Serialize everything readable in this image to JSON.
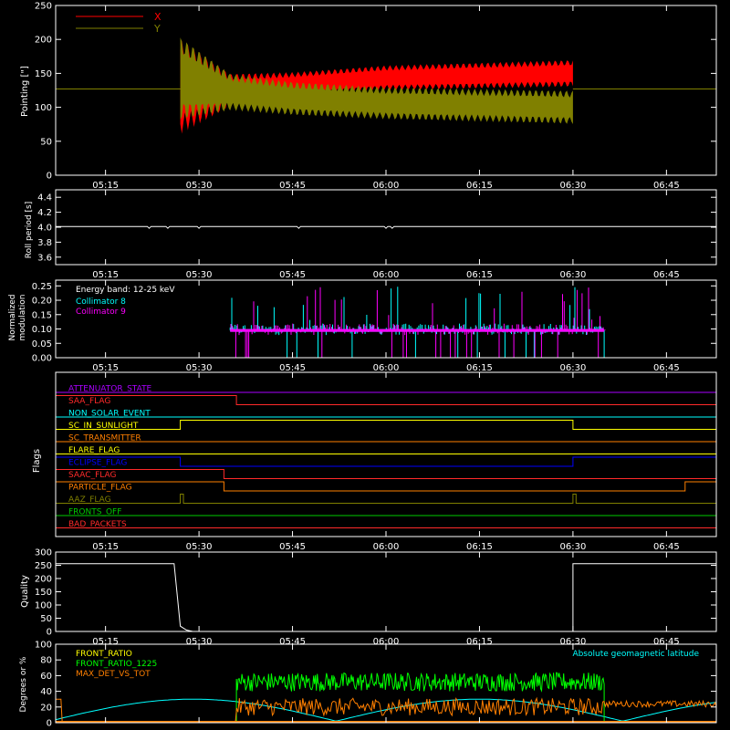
{
  "x_ticks": [
    "05:15",
    "05:30",
    "05:45",
    "06:00",
    "06:15",
    "06:30",
    "06:45"
  ],
  "panels": {
    "pointing": {
      "ylabel": "Pointing [\"]",
      "yticks": [
        "0",
        "50",
        "100",
        "150",
        "200",
        "250"
      ]
    },
    "roll": {
      "ylabel": "Roll period [s]",
      "yticks": [
        "3.6",
        "3.8",
        "4.0",
        "4.2",
        "4.4"
      ]
    },
    "modulation": {
      "ylabel_lines": [
        "Normalized",
        "modulation"
      ],
      "yticks": [
        "0.00",
        "0.05",
        "0.10",
        "0.15",
        "0.20",
        "0.25"
      ],
      "annotation": "Energy band: 12-25 keV"
    },
    "flags": {
      "ylabel": "Flags"
    },
    "quality": {
      "ylabel": "Quality",
      "yticks": [
        "0",
        "50",
        "100",
        "150",
        "200",
        "250",
        "300"
      ]
    },
    "ratios": {
      "ylabel": "Degrees or %",
      "yticks": [
        "0",
        "20",
        "40",
        "60",
        "80",
        "100"
      ],
      "annotation": "Absolute geomagnetic latitude"
    }
  },
  "chart_data": [
    {
      "type": "line",
      "panel": "pointing",
      "xlabel": "",
      "ylabel": "Pointing [\"]",
      "xlim": [
        "05:07",
        "06:53"
      ],
      "ylim": [
        0,
        250
      ],
      "series": [
        {
          "name": "X",
          "color": "#ff0000",
          "flat": 127,
          "start": "05:27",
          "end": "06:30",
          "envelope": [
            {
              "t": "05:27",
              "lo": 60,
              "hi": 200
            },
            {
              "t": "05:35",
              "lo": 100,
              "hi": 150
            },
            {
              "t": "05:45",
              "lo": 115,
              "hi": 152
            },
            {
              "t": "06:00",
              "lo": 125,
              "hi": 162
            },
            {
              "t": "06:30",
              "lo": 130,
              "hi": 170
            }
          ]
        },
        {
          "name": "Y",
          "color": "#808000",
          "flat": 127,
          "start": "05:27",
          "end": "06:30",
          "envelope": [
            {
              "t": "05:27",
              "lo": 80,
              "hi": 205
            },
            {
              "t": "05:35",
              "lo": 95,
              "hi": 150
            },
            {
              "t": "05:45",
              "lo": 88,
              "hi": 138
            },
            {
              "t": "06:00",
              "lo": 82,
              "hi": 130
            },
            {
              "t": "06:30",
              "lo": 75,
              "hi": 125
            }
          ]
        }
      ]
    },
    {
      "type": "line",
      "panel": "roll",
      "ylabel": "Roll period [s]",
      "ylim": [
        3.5,
        4.5
      ],
      "series": [
        {
          "name": "",
          "color": "#ffffff",
          "value": 4.01,
          "dips_at": [
            "05:22",
            "05:25",
            "05:30",
            "05:46",
            "06:00",
            "06:01"
          ]
        }
      ]
    },
    {
      "type": "bar",
      "panel": "modulation",
      "ylabel": "Normalized modulation",
      "ylim": [
        0,
        0.27
      ],
      "annotation": "Energy band: 12-25 keV",
      "start": "05:35",
      "end": "06:35",
      "series": [
        {
          "name": "Collimator 8",
          "color": "#00ffff",
          "base": 0.095
        },
        {
          "name": "Collimator 9",
          "color": "#ff00ff",
          "base": 0.095
        }
      ]
    },
    {
      "type": "line",
      "panel": "flags",
      "series": [
        {
          "name": "ATTENUATOR_STATE",
          "color": "#aa00ff",
          "steps": [
            [
              "05:07",
              0
            ],
            [
              "06:53",
              0
            ]
          ]
        },
        {
          "name": "SAA_FLAG",
          "color": "#ff2a2a",
          "steps": [
            [
              "05:07",
              1
            ],
            [
              "05:36",
              0
            ],
            [
              "06:53",
              0
            ]
          ]
        },
        {
          "name": "NON_SOLAR_EVENT",
          "color": "#00ffff",
          "steps": [
            [
              "05:07",
              0
            ],
            [
              "06:53",
              0
            ]
          ]
        },
        {
          "name": "SC_IN_SUNLIGHT",
          "color": "#ffff00",
          "steps": [
            [
              "05:07",
              0
            ],
            [
              "05:27",
              1
            ],
            [
              "06:30",
              0
            ],
            [
              "06:53",
              0
            ]
          ]
        },
        {
          "name": "SC_TRANSMITTER",
          "color": "#ff7f00",
          "steps": [
            [
              "05:07",
              0
            ],
            [
              "06:53",
              0
            ]
          ]
        },
        {
          "name": "FLARE_FLAG",
          "color": "#ffff00",
          "steps": [
            [
              "05:07",
              0
            ],
            [
              "06:53",
              0
            ]
          ]
        },
        {
          "name": "ECLIPSE_FLAG",
          "color": "#0000ff",
          "steps": [
            [
              "05:07",
              1
            ],
            [
              "05:27",
              0
            ],
            [
              "06:30",
              1
            ],
            [
              "06:53",
              1
            ]
          ]
        },
        {
          "name": "SAAC_FLAG",
          "color": "#ff2a2a",
          "steps": [
            [
              "05:07",
              1
            ],
            [
              "05:34",
              0
            ],
            [
              "06:53",
              0
            ]
          ]
        },
        {
          "name": "PARTICLE_FLAG",
          "color": "#ff7f00",
          "steps": [
            [
              "05:07",
              1
            ],
            [
              "05:34",
              0
            ],
            [
              "06:48",
              1
            ],
            [
              "06:53",
              1
            ]
          ]
        },
        {
          "name": "AAZ_FLAG",
          "color": "#808000",
          "steps": [
            [
              "05:07",
              0
            ],
            [
              "05:27",
              1
            ],
            [
              "05:27.5",
              0
            ],
            [
              "06:30",
              1
            ],
            [
              "06:30.5",
              0
            ],
            [
              "06:53",
              0
            ]
          ]
        },
        {
          "name": "FRONTS_OFF",
          "color": "#00cc00",
          "steps": [
            [
              "05:07",
              0
            ],
            [
              "06:53",
              0
            ]
          ]
        },
        {
          "name": "BAD_PACKETS",
          "color": "#ff2a2a",
          "steps": [
            [
              "05:07",
              0
            ],
            [
              "06:53",
              0
            ]
          ]
        }
      ]
    },
    {
      "type": "line",
      "panel": "quality",
      "ylabel": "Quality",
      "ylim": [
        0,
        300
      ],
      "series": [
        {
          "name": "",
          "color": "#ffffff",
          "steps": [
            [
              "05:07",
              256
            ],
            [
              "05:26",
              256
            ],
            [
              "05:27",
              20
            ],
            [
              "05:28",
              5
            ],
            [
              "05:29",
              0
            ],
            [
              "06:30",
              0
            ],
            [
              "06:30",
              256
            ],
            [
              "06:53",
              256
            ]
          ]
        }
      ]
    },
    {
      "type": "line",
      "panel": "ratios",
      "ylabel": "Degrees or %",
      "ylim": [
        0,
        100
      ],
      "annotation": "Absolute geomagnetic latitude",
      "series": [
        {
          "name": "FRONT_RATIO",
          "color": "#ffff00"
        },
        {
          "name": "FRONT_RATIO_1225",
          "color": "#00ff00",
          "level": 52,
          "start": "05:36",
          "end": "06:35"
        },
        {
          "name": "MAX_DET_VS_TOT",
          "color": "#ff7f00",
          "level": 18
        },
        {
          "name": "Absolute geomagnetic latitude",
          "color": "#00ffff"
        }
      ]
    }
  ]
}
